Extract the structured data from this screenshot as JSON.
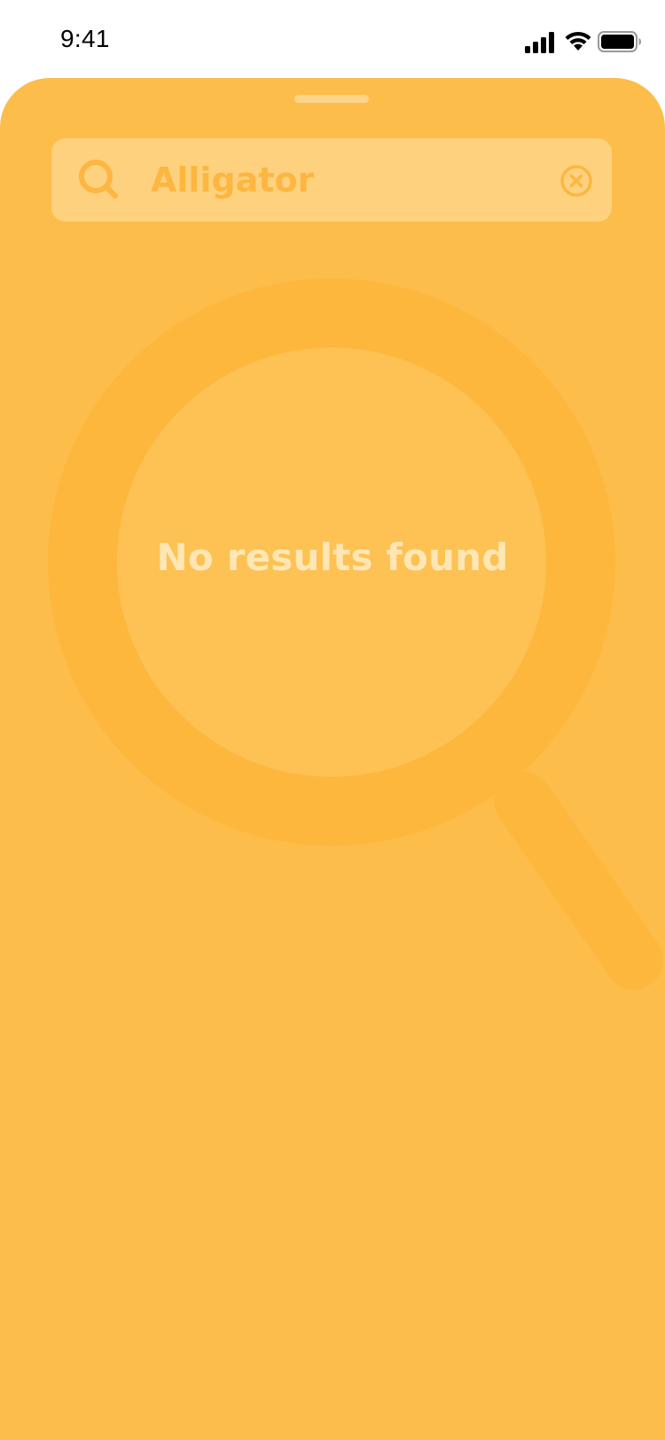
{
  "status_bar": {
    "time": "9:41",
    "icons": [
      "cellular-signal-icon",
      "wifi-icon",
      "battery-icon"
    ]
  },
  "search": {
    "value": "Alligator",
    "placeholder": "",
    "search_icon": "search-icon",
    "clear_icon": "clear-circle-icon"
  },
  "empty_state": {
    "message": "No results found",
    "illustration": "magnifying-glass-icon"
  },
  "colors": {
    "sheet_background": "#FDBD4A",
    "search_field_background": "#FED17E",
    "accent": "#FDB640",
    "illustration": "#FDB73C",
    "illustration_inner": "#FDC253",
    "message_text": "#FFE6B4",
    "grabber": "#FFE8C0"
  }
}
